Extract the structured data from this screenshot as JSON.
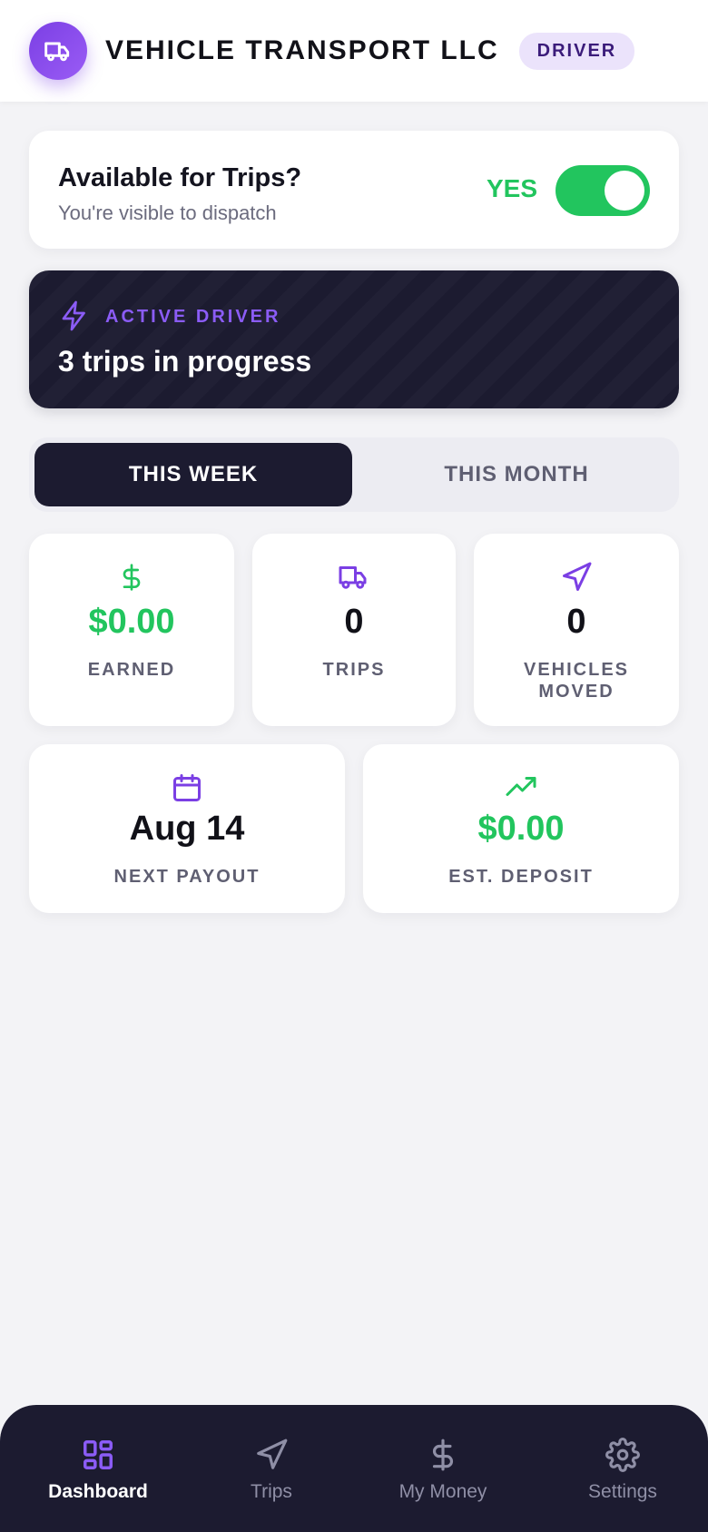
{
  "header": {
    "title": "VEHICLE TRANSPORT LLC",
    "role_badge": "DRIVER",
    "logo_icon": "truck-icon"
  },
  "availability": {
    "title": "Available for Trips?",
    "subtitle": "You're visible to dispatch",
    "status_label": "YES",
    "toggle_on": true
  },
  "banner": {
    "icon": "lightning-icon",
    "label": "ACTIVE DRIVER",
    "text": "3 trips in progress"
  },
  "period_tabs": {
    "selected": "THIS WEEK",
    "options": [
      "THIS WEEK",
      "THIS MONTH"
    ]
  },
  "stats": [
    {
      "icon": "dollar-icon",
      "value": "$0.00",
      "label": "EARNED"
    },
    {
      "icon": "truck-icon",
      "value": "0",
      "label": "TRIPS"
    },
    {
      "icon": "navigation-icon",
      "value": "0",
      "label": "VEHICLES MOVED"
    },
    {
      "icon": "calendar-icon",
      "value": "Aug 14",
      "label": "NEXT PAYOUT"
    },
    {
      "icon": "trending-up-icon",
      "value": "$0.00",
      "label": "EST. DEPOSIT"
    }
  ],
  "bottom_nav": {
    "active": "Dashboard",
    "items": [
      {
        "label": "Dashboard",
        "icon": "dashboard-icon"
      },
      {
        "label": "Trips",
        "icon": "navigation-icon"
      },
      {
        "label": "My Money",
        "icon": "dollar-icon"
      },
      {
        "label": "Settings",
        "icon": "gear-icon"
      }
    ]
  },
  "colors": {
    "accent_purple": "#7b3fe4",
    "success_green": "#22c55e",
    "dark_navy": "#1c1b30",
    "background": "#f3f3f6"
  }
}
